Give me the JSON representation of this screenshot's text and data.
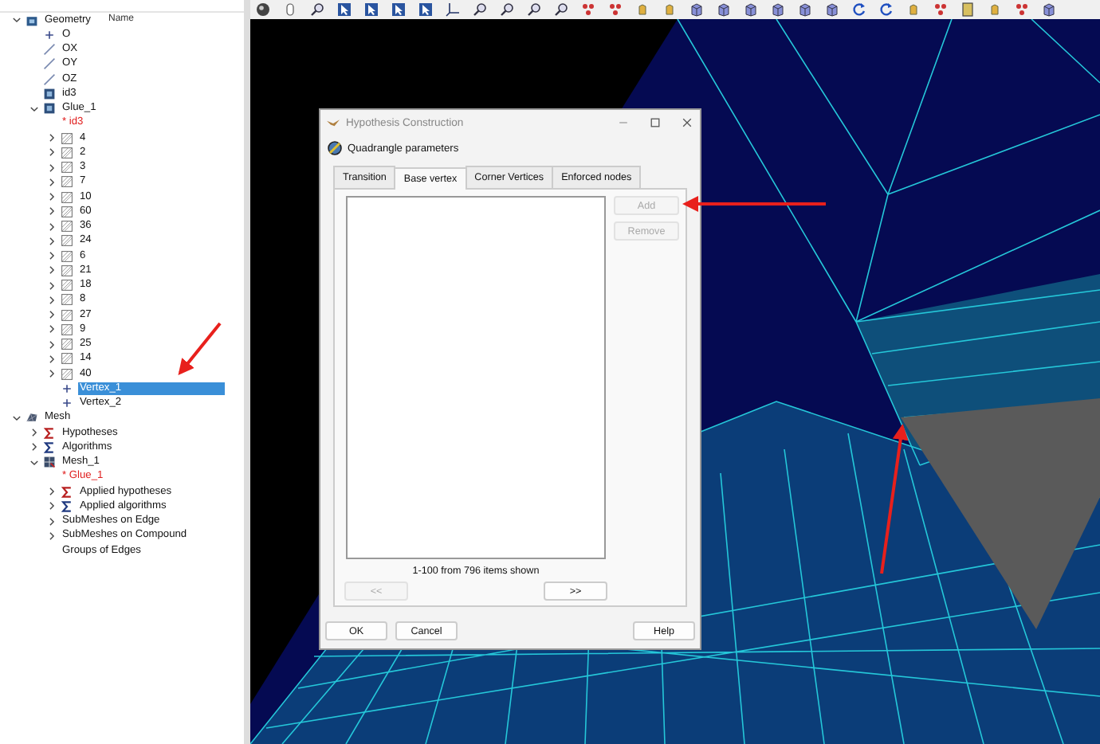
{
  "tree": {
    "header": "Name",
    "items": [
      {
        "label": "Geometry",
        "kind": "geometry",
        "expanded": true,
        "selected": false,
        "children": [
          {
            "label": "O",
            "kind": "point",
            "selected": false
          },
          {
            "label": "OX",
            "kind": "line",
            "selected": false
          },
          {
            "label": "OY",
            "kind": "line",
            "selected": false
          },
          {
            "label": "OZ",
            "kind": "line",
            "selected": false
          },
          {
            "label": "id3",
            "kind": "shape",
            "selected": false
          },
          {
            "label": "Glue_1",
            "kind": "shape",
            "expanded": true,
            "selected": false,
            "children": [
              {
                "label": "* id3",
                "kind": "reference",
                "selected": false
              },
              {
                "label": "4",
                "kind": "group",
                "expanded": false,
                "selected": false
              },
              {
                "label": "2",
                "kind": "group",
                "expanded": false,
                "selected": false
              },
              {
                "label": "3",
                "kind": "group",
                "expanded": false,
                "selected": false
              },
              {
                "label": "7",
                "kind": "group",
                "expanded": false,
                "selected": false
              },
              {
                "label": "10",
                "kind": "group",
                "expanded": false,
                "selected": false
              },
              {
                "label": "60",
                "kind": "group",
                "expanded": false,
                "selected": false
              },
              {
                "label": "36",
                "kind": "group",
                "expanded": false,
                "selected": false
              },
              {
                "label": "24",
                "kind": "group",
                "expanded": false,
                "selected": false
              },
              {
                "label": "6",
                "kind": "group",
                "expanded": false,
                "selected": false
              },
              {
                "label": "21",
                "kind": "group",
                "expanded": false,
                "selected": false
              },
              {
                "label": "18",
                "kind": "group",
                "expanded": false,
                "selected": false
              },
              {
                "label": "8",
                "kind": "group",
                "expanded": false,
                "selected": false
              },
              {
                "label": "27",
                "kind": "group",
                "expanded": false,
                "selected": false
              },
              {
                "label": "9",
                "kind": "group",
                "expanded": false,
                "selected": false
              },
              {
                "label": "25",
                "kind": "group",
                "expanded": false,
                "selected": false
              },
              {
                "label": "14",
                "kind": "group",
                "expanded": false,
                "selected": false
              },
              {
                "label": "40",
                "kind": "group",
                "expanded": false,
                "selected": false
              },
              {
                "label": "Vertex_1",
                "kind": "point",
                "selected": true
              },
              {
                "label": "Vertex_2",
                "kind": "point",
                "selected": false
              }
            ]
          }
        ]
      },
      {
        "label": "Mesh",
        "kind": "mesh",
        "expanded": true,
        "selected": false,
        "children": [
          {
            "label": "Hypotheses",
            "kind": "hypotheses",
            "expanded": false,
            "selected": false
          },
          {
            "label": "Algorithms",
            "kind": "algorithms",
            "expanded": false,
            "selected": false
          },
          {
            "label": "Mesh_1",
            "kind": "meshobj",
            "expanded": true,
            "selected": false,
            "children": [
              {
                "label": "* Glue_1",
                "kind": "reference",
                "selected": false
              },
              {
                "label": "Applied hypotheses",
                "kind": "hypotheses",
                "expanded": false,
                "selected": false
              },
              {
                "label": "Applied algorithms",
                "kind": "algorithms",
                "expanded": false,
                "selected": false
              },
              {
                "label": "SubMeshes on Edge",
                "kind": "folder",
                "expanded": false,
                "selected": false
              },
              {
                "label": "SubMeshes on Compound",
                "kind": "folder",
                "expanded": false,
                "selected": false
              },
              {
                "label": "Groups of Edges",
                "kind": "folder",
                "selected": false
              }
            ]
          }
        ]
      }
    ]
  },
  "dialog": {
    "title": "Hypothesis Construction",
    "header": "Quadrangle parameters",
    "tabs": [
      {
        "label": "Transition",
        "selected": false
      },
      {
        "label": "Base vertex",
        "selected": true
      },
      {
        "label": "Corner Vertices",
        "selected": false
      },
      {
        "label": "Enforced nodes",
        "selected": false
      }
    ],
    "side_buttons": [
      {
        "label": "Add",
        "disabled": true
      },
      {
        "label": "Remove",
        "disabled": true
      }
    ],
    "status": "1-100 from 796 items shown",
    "pager": [
      {
        "label": "<<",
        "disabled": true
      },
      {
        "label": ">>",
        "disabled": false
      }
    ],
    "buttons": [
      {
        "label": "OK",
        "kind": "left"
      },
      {
        "label": "Cancel",
        "kind": "left"
      },
      {
        "label": "Help",
        "kind": "right"
      }
    ]
  }
}
